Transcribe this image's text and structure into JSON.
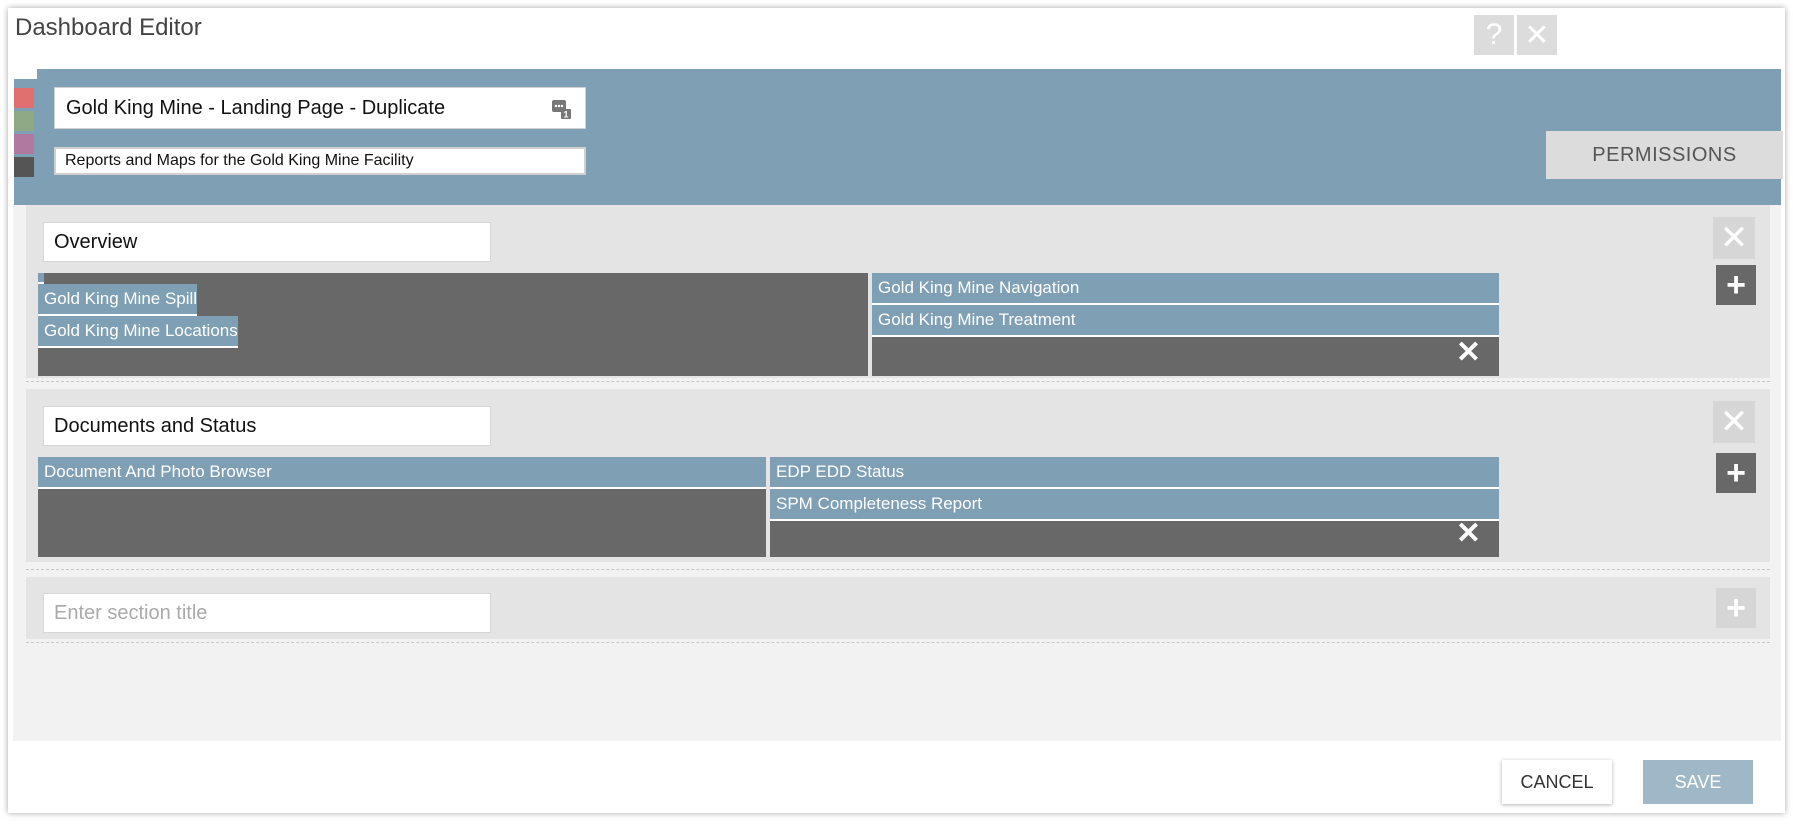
{
  "window": {
    "title": "Dashboard Editor",
    "help_label": "?",
    "close_label": "✕"
  },
  "swatches": [
    "#e07070",
    "#8fa985",
    "#b07aa0",
    "#555555"
  ],
  "header": {
    "name_value": "Gold King Mine - Landing Page - Duplicate",
    "description_value": "Reports and Maps for the Gold King Mine Facility",
    "permissions_label": "PERMISSIONS",
    "background": "#7fa0b4"
  },
  "sections": [
    {
      "title": "Overview",
      "columns": [
        {
          "widgets": [
            "",
            "Gold King Mine Spill",
            "Gold King Mine Locations"
          ]
        },
        {
          "widgets": [
            "Gold King Mine Navigation",
            "Gold King Mine Treatment"
          ]
        }
      ]
    },
    {
      "title": "Documents and Status",
      "columns": [
        {
          "widgets": [
            "Document And Photo Browser"
          ]
        },
        {
          "widgets": [
            "EDP EDD Status",
            "SPM Completeness Report"
          ]
        }
      ]
    }
  ],
  "new_section": {
    "placeholder": "Enter section title"
  },
  "icons": {
    "remove": "✕",
    "add": "+"
  },
  "footer": {
    "cancel_label": "CANCEL",
    "save_label": "SAVE"
  }
}
